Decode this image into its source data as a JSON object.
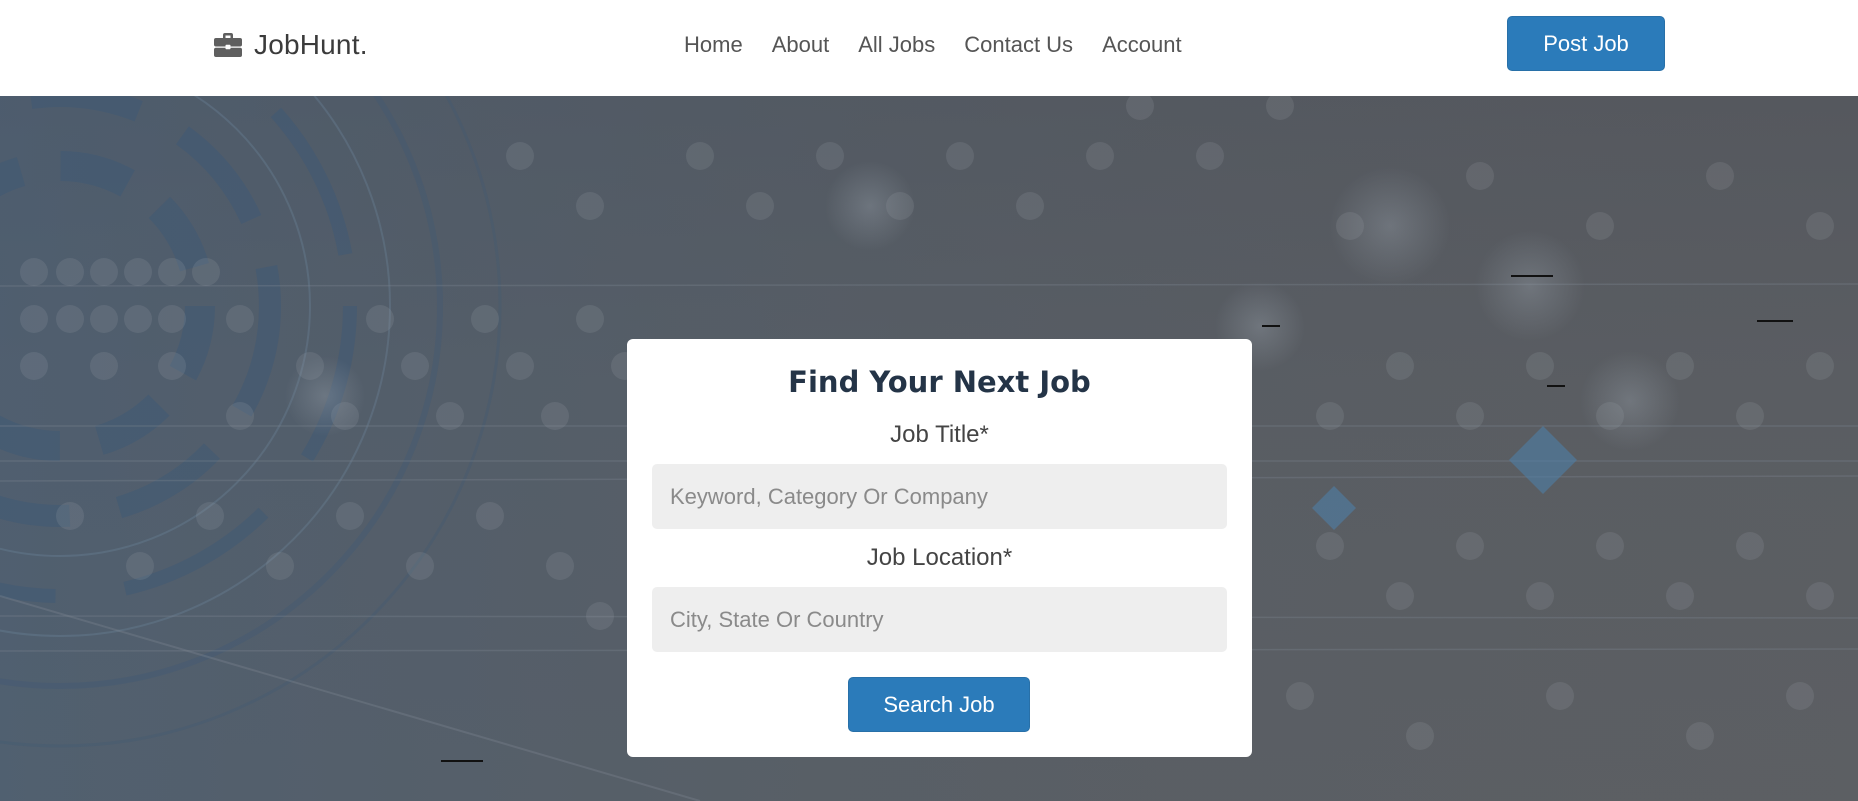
{
  "header": {
    "brand": {
      "icon": "briefcase-icon",
      "name": "JobHunt."
    },
    "nav": [
      {
        "label": "Home"
      },
      {
        "label": "About"
      },
      {
        "label": "All Jobs"
      },
      {
        "label": "Contact Us"
      },
      {
        "label": "Account"
      }
    ],
    "post_job_label": "Post Job"
  },
  "search": {
    "title": "Find Your Next Job",
    "job_title_label": "Job Title*",
    "job_title_placeholder": "Keyword, Category Or Company",
    "job_title_value": "",
    "location_label": "Job Location*",
    "location_placeholder": "City, State Or Country",
    "location_value": "",
    "submit_label": "Search Job"
  },
  "colors": {
    "accent": "#2b7bba",
    "title": "#243447",
    "input_bg": "#eeeeee",
    "hero_overlay": "#55585e"
  }
}
